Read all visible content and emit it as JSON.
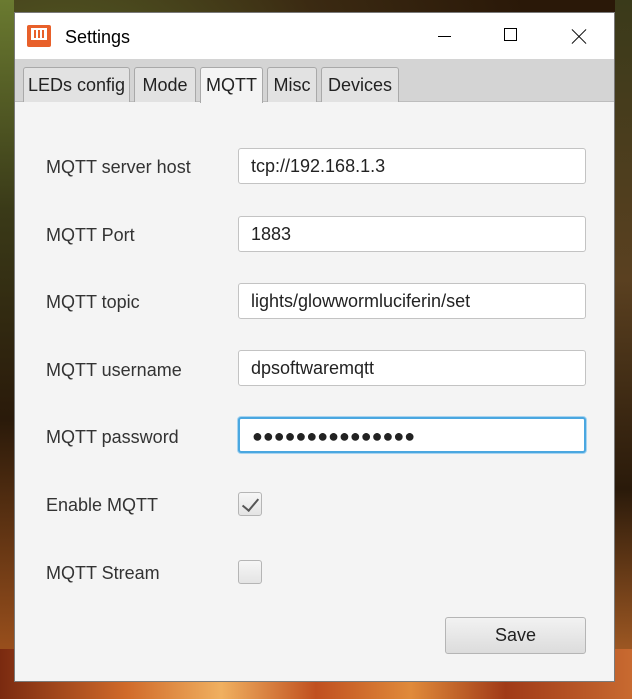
{
  "window": {
    "title": "Settings"
  },
  "tabs": [
    {
      "label": "LEDs config"
    },
    {
      "label": "Mode"
    },
    {
      "label": "MQTT"
    },
    {
      "label": "Misc"
    },
    {
      "label": "Devices"
    }
  ],
  "active_tab": "MQTT",
  "form": {
    "server_host": {
      "label": "MQTT server host",
      "value": "tcp://192.168.1.3"
    },
    "port": {
      "label": "MQTT Port",
      "value": "1883"
    },
    "topic": {
      "label": "MQTT topic",
      "value": "lights/glowwormluciferin/set"
    },
    "username": {
      "label": "MQTT username",
      "value": "dpsoftwaremqtt"
    },
    "password": {
      "label": "MQTT password",
      "masked": "●●●●●●●●●●●●●●●"
    },
    "enable": {
      "label": "Enable MQTT",
      "checked": true
    },
    "stream": {
      "label": "MQTT Stream",
      "checked": false
    }
  },
  "actions": {
    "save_label": "Save"
  },
  "colors": {
    "accent_focus": "#4aa7e0",
    "app_icon": "#e8602a"
  },
  "icons": {
    "app": "glowworm-app-icon",
    "minimize": "minimize-icon",
    "maximize": "maximize-icon",
    "close": "close-icon",
    "check": "checkmark-icon"
  }
}
